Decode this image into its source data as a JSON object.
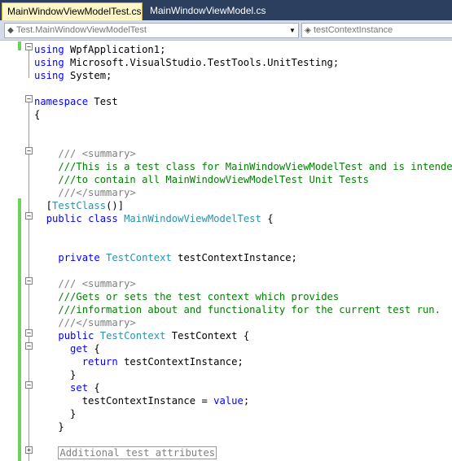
{
  "tabs": [
    {
      "label": "MainWindowViewModelTest.cs",
      "active": true
    },
    {
      "label": "MainWindowViewModel.cs",
      "active": false
    }
  ],
  "nav": {
    "type_combo": "Test.MainWindowViewModelTest",
    "member_combo": "testContextInstance"
  },
  "colors": {
    "keyword": "#0000ff",
    "type": "#2b91af",
    "comment": "#008000",
    "change_bar": "#6fd15a",
    "tab_strip": "#2d3f5e",
    "active_tab": "#fff7c8"
  },
  "code_lines": [
    [
      {
        "t": "using",
        "c": "kw"
      },
      {
        "t": " WpfApplication1;"
      }
    ],
    [
      {
        "t": "using",
        "c": "kw"
      },
      {
        "t": " Microsoft.VisualStudio.TestTools.UnitTesting;"
      }
    ],
    [
      {
        "t": "using",
        "c": "kw"
      },
      {
        "t": " System;"
      }
    ],
    [],
    [
      {
        "t": "namespace",
        "c": "kw"
      },
      {
        "t": " Test"
      }
    ],
    [
      {
        "t": "{"
      }
    ],
    [],
    [],
    [
      {
        "t": "    "
      },
      {
        "t": "/// <summary>",
        "c": "xd"
      }
    ],
    [
      {
        "t": "    "
      },
      {
        "t": "///This is a test class for MainWindowViewModelTest and is intended",
        "c": "cm"
      }
    ],
    [
      {
        "t": "    "
      },
      {
        "t": "///to contain all MainWindowViewModelTest Unit Tests",
        "c": "cm"
      }
    ],
    [
      {
        "t": "    "
      },
      {
        "t": "///</summary>",
        "c": "xd"
      }
    ],
    [
      {
        "t": "  ["
      },
      {
        "t": "TestClass",
        "c": "ty"
      },
      {
        "t": "()]"
      }
    ],
    [
      {
        "t": "  "
      },
      {
        "t": "public",
        "c": "kw"
      },
      {
        "t": " "
      },
      {
        "t": "class",
        "c": "kw"
      },
      {
        "t": " "
      },
      {
        "t": "MainWindowViewModelTest",
        "c": "ty"
      },
      {
        "t": " {"
      }
    ],
    [],
    [],
    [
      {
        "t": "    "
      },
      {
        "t": "private",
        "c": "kw"
      },
      {
        "t": " "
      },
      {
        "t": "TestContext",
        "c": "ty"
      },
      {
        "t": " testContextInstance;"
      }
    ],
    [],
    [
      {
        "t": "    "
      },
      {
        "t": "/// <summary>",
        "c": "xd"
      }
    ],
    [
      {
        "t": "    "
      },
      {
        "t": "///Gets or sets the test context which provides",
        "c": "cm"
      }
    ],
    [
      {
        "t": "    "
      },
      {
        "t": "///information about and functionality for the current test run.",
        "c": "cm"
      }
    ],
    [
      {
        "t": "    "
      },
      {
        "t": "///</summary>",
        "c": "xd"
      }
    ],
    [
      {
        "t": "    "
      },
      {
        "t": "public",
        "c": "kw"
      },
      {
        "t": " "
      },
      {
        "t": "TestContext",
        "c": "ty"
      },
      {
        "t": " TestContext {"
      }
    ],
    [
      {
        "t": "      "
      },
      {
        "t": "get",
        "c": "kw"
      },
      {
        "t": " {"
      }
    ],
    [
      {
        "t": "        "
      },
      {
        "t": "return",
        "c": "kw"
      },
      {
        "t": " testContextInstance;"
      }
    ],
    [
      {
        "t": "      }"
      }
    ],
    [
      {
        "t": "      "
      },
      {
        "t": "set",
        "c": "kw"
      },
      {
        "t": " {"
      }
    ],
    [
      {
        "t": "        testContextInstance = "
      },
      {
        "t": "value",
        "c": "kw"
      },
      {
        "t": ";"
      }
    ],
    [
      {
        "t": "      }"
      }
    ],
    [
      {
        "t": "    }"
      }
    ],
    [],
    [
      {
        "t": "    "
      },
      {
        "t": "Additional test attributes",
        "c": "collapsed"
      }
    ]
  ]
}
